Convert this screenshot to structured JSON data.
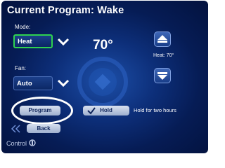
{
  "header": {
    "title": "Current Program: Wake"
  },
  "mode": {
    "label": "Mode:",
    "value": "Heat"
  },
  "fan": {
    "label": "Fan:",
    "value": "Auto"
  },
  "current_temp": "70°",
  "setpoint": {
    "label": "Heat: 70°"
  },
  "buttons": {
    "program": "Program",
    "hold": "Hold",
    "back": "Back"
  },
  "hold_info": "Hold for two hours",
  "logo": "Control",
  "colors": {
    "accent_focus": "#2fd24f",
    "background": "#0d2f7a",
    "button": "#c4cfe4"
  },
  "icons": [
    "chevron-down-icon",
    "arrow-up-icon",
    "arrow-down-icon",
    "checkmark-icon",
    "back-arrows-icon",
    "control4-logo-icon"
  ]
}
